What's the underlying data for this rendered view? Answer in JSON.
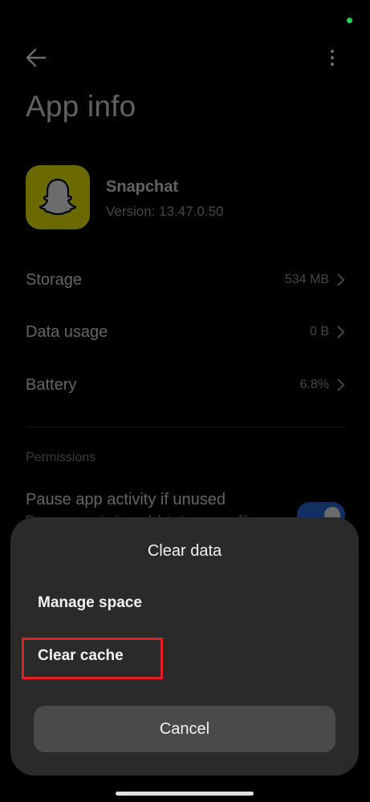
{
  "header": {
    "title": "App info"
  },
  "app": {
    "name": "Snapchat",
    "version": "Version: 13.47.0.50",
    "icon": "snapchat-ghost-icon",
    "brand_color": "#fffc00"
  },
  "rows": {
    "storage": {
      "label": "Storage",
      "value": "534 MB"
    },
    "data_usage": {
      "label": "Data usage",
      "value": "0 B"
    },
    "battery": {
      "label": "Battery",
      "value": "6.8%"
    }
  },
  "permissions": {
    "section_label": "Permissions",
    "pause_title": "Pause app activity if unused",
    "pause_subtitle": "Remove permissions, delete temporary files",
    "pause_enabled": true
  },
  "sheet": {
    "title": "Clear data",
    "manage_space": "Manage space",
    "clear_cache": "Clear cache",
    "cancel": "Cancel"
  },
  "colors": {
    "accent": "#2f6fe6",
    "highlight": "#e41e26",
    "status_dot": "#2bd15b"
  }
}
